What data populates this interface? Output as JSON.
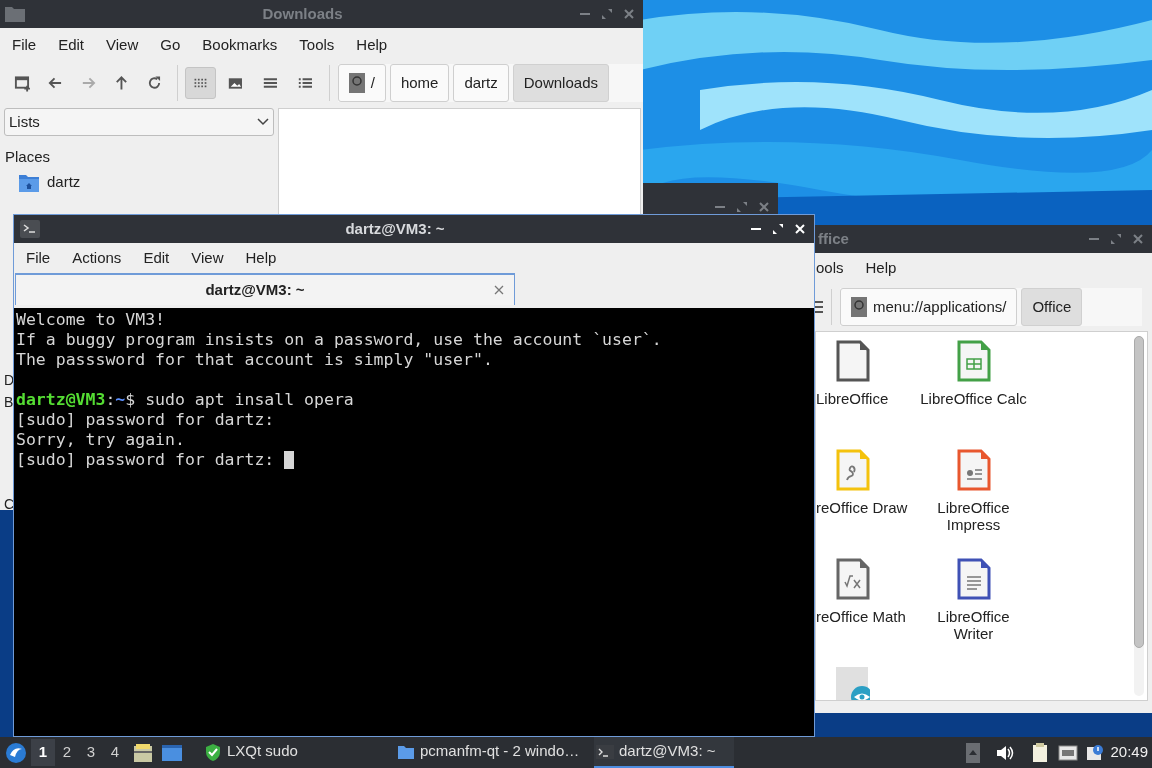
{
  "file_manager": {
    "title": "Downloads",
    "active": false,
    "menu": [
      "File",
      "Edit",
      "View",
      "Go",
      "Bookmarks",
      "Tools",
      "Help"
    ],
    "nav": [
      {
        "kind": "new_window",
        "disabled": false
      },
      {
        "kind": "back",
        "disabled": false
      },
      {
        "kind": "forward",
        "disabled": true
      },
      {
        "kind": "up",
        "disabled": false
      },
      {
        "kind": "reload",
        "disabled": false
      }
    ],
    "view_modes": [
      {
        "kind": "icons",
        "selected": true
      },
      {
        "kind": "thumbnails",
        "selected": false
      },
      {
        "kind": "compact",
        "selected": false
      },
      {
        "kind": "details",
        "selected": false
      }
    ],
    "path": [
      {
        "label": "/",
        "kind": "root",
        "selected": false
      },
      {
        "label": "home",
        "kind": "dir",
        "selected": false
      },
      {
        "label": "dartz",
        "kind": "dir",
        "selected": false
      },
      {
        "label": "Downloads",
        "kind": "dir",
        "selected": true
      }
    ],
    "side_pane": {
      "mode": "Lists",
      "heading": "Places",
      "items": [
        {
          "label": "dartz",
          "kind": "home"
        }
      ],
      "cut_labels": [
        "D",
        "B",
        "C"
      ]
    }
  },
  "back_window": {
    "active": false
  },
  "office_window": {
    "title": "ffice",
    "active": false,
    "menu": [
      "ools",
      "Help"
    ],
    "path": [
      {
        "label": "menu://applications/",
        "kind": "root",
        "selected": false
      },
      {
        "label": "Office",
        "kind": "dir",
        "selected": true
      }
    ],
    "apps": [
      {
        "label": "LibreOffice",
        "kind": "generic",
        "color": "#555555"
      },
      {
        "label": "LibreOffice Calc",
        "kind": "calc",
        "color": "#43a047"
      },
      {
        "label": "reOffice Draw",
        "kind": "draw",
        "color": "#f4c20d"
      },
      {
        "label": "LibreOffice Impress",
        "kind": "impress",
        "color": "#e8572e"
      },
      {
        "label": "reOffice Math",
        "kind": "math",
        "color": "#666666"
      },
      {
        "label": "LibreOffice Writer",
        "kind": "writer",
        "color": "#3f51b5"
      },
      {
        "kind": "viewer",
        "color": "#2b9fc4"
      }
    ]
  },
  "terminal": {
    "title": "dartz@VM3: ~",
    "active": true,
    "menu": [
      "File",
      "Actions",
      "Edit",
      "View",
      "Help"
    ],
    "tabs": [
      {
        "label": "dartz@VM3: ~",
        "selected": true
      }
    ],
    "lines": [
      {
        "kind": "text",
        "segments": [
          {
            "text": "Welcome to VM3!",
            "kind": "plain"
          }
        ]
      },
      {
        "kind": "text",
        "segments": [
          {
            "text": "If a buggy program insists on a password, use the account `user`.",
            "kind": "plain"
          }
        ]
      },
      {
        "kind": "text",
        "segments": [
          {
            "text": "The passsword for that account is simply \"user\".",
            "kind": "plain"
          }
        ]
      },
      {
        "kind": "blank"
      },
      {
        "kind": "text",
        "segments": [
          {
            "text": "dartz@VM3",
            "kind": "user"
          },
          {
            "text": ":",
            "kind": "plain"
          },
          {
            "text": "~",
            "kind": "path"
          },
          {
            "text": "$ sudo apt insall opera",
            "kind": "plain"
          }
        ]
      },
      {
        "kind": "text",
        "segments": [
          {
            "text": "[sudo] password for dartz:",
            "kind": "plain"
          }
        ]
      },
      {
        "kind": "text",
        "segments": [
          {
            "text": "Sorry, try again.",
            "kind": "plain"
          }
        ]
      },
      {
        "kind": "text",
        "segments": [
          {
            "text": "[sudo] password for dartz:",
            "kind": "plain"
          },
          {
            "kind": "cursor"
          }
        ]
      }
    ]
  },
  "taskbar": {
    "desktops": [
      {
        "label": "1",
        "selected": true
      },
      {
        "label": "2",
        "selected": false
      },
      {
        "label": "3",
        "selected": false
      },
      {
        "label": "4",
        "selected": false
      }
    ],
    "tasks": [
      {
        "label": "LXQt sudo",
        "kind": "shield",
        "selected": false
      },
      {
        "label": "pcmanfm-qt - 2 windo…",
        "kind": "folder",
        "selected": false
      },
      {
        "label": "dartz@VM3: ~",
        "kind": "terminal",
        "selected": true
      }
    ],
    "clock": "20:49"
  }
}
